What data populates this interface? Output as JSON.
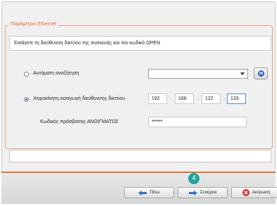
{
  "group_title": "Παράμετροι Ethernet",
  "instruction": "Εισάγετε τη διεύθυνση δικτύου της συσκευής και τον κωδικό OPEN",
  "auto_search": {
    "label": "Αυτόματη αναζήτηση",
    "selected_value": ""
  },
  "manual_entry": {
    "label": "Χειροκίνητη εισαγωγή διεύθυνσης δικτύου",
    "ip": [
      "192",
      "168",
      "122",
      "133"
    ]
  },
  "password": {
    "label": "Κωδικός πρόσβασης ΑΝΟΙΓΜΑΤΟΣ",
    "value": "*****"
  },
  "buttons": {
    "back": "Πίσω",
    "next": "Συνέχεια",
    "cancel": "Ακύρωση"
  },
  "step_badge": "4",
  "colors": {
    "accent": "#e8732e",
    "badge": "#1fa3a0"
  }
}
